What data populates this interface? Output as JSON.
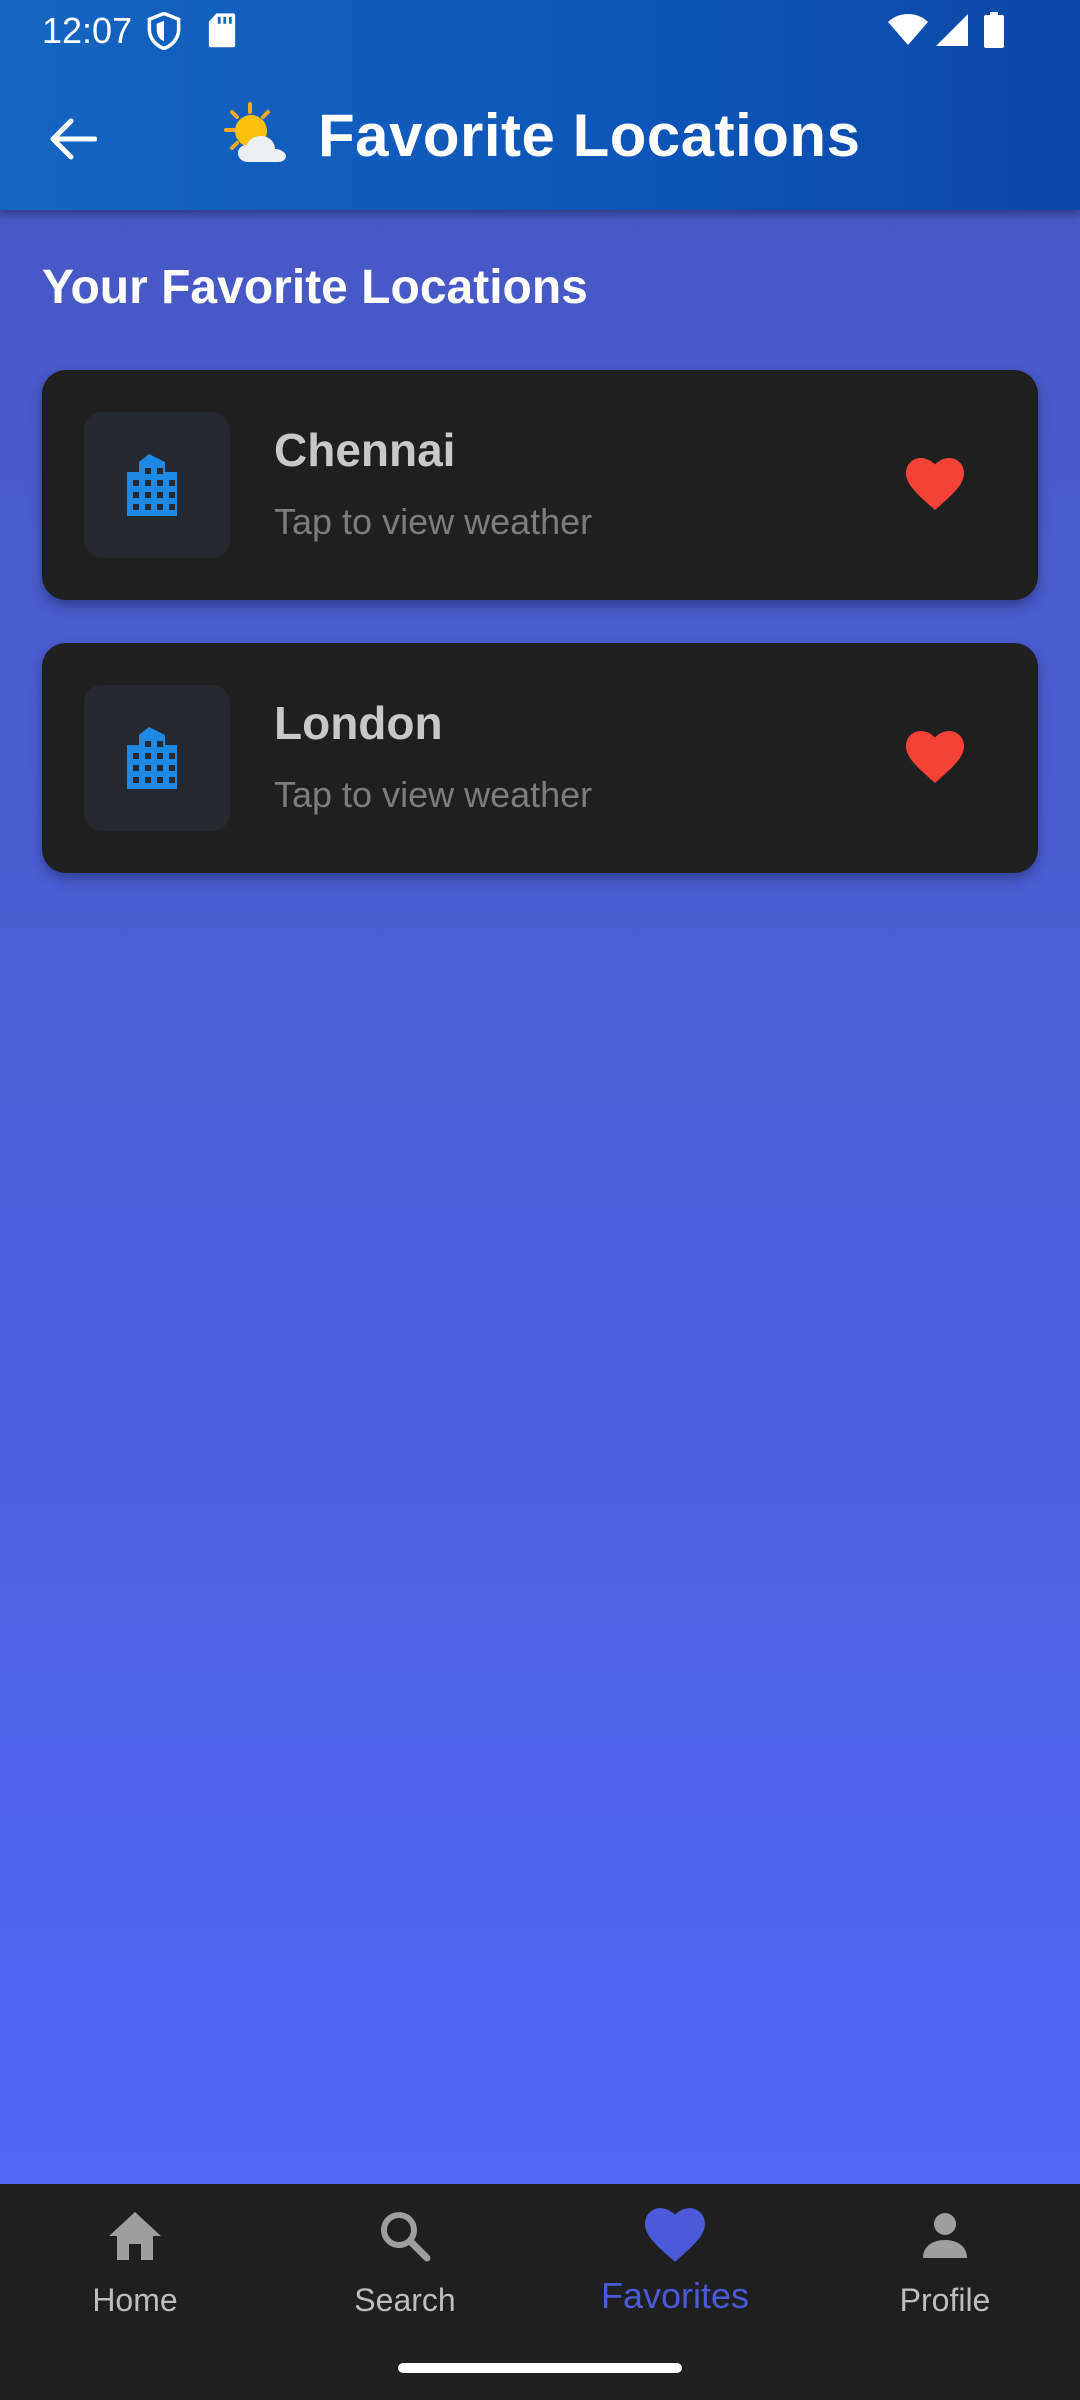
{
  "status_bar": {
    "time": "12:07",
    "icons": [
      "shield-icon",
      "sd-card-icon",
      "wifi-icon",
      "cellular-signal-icon",
      "battery-icon"
    ]
  },
  "app_bar": {
    "back_icon": "arrow-left-icon",
    "weather_icon": "sun-cloud-icon",
    "title": "Favorite Locations"
  },
  "main": {
    "section_title": "Your Favorite Locations",
    "favorites": [
      {
        "name": "Chennai",
        "subtitle": "Tap to view weather",
        "icon": "city-icon",
        "favorite_icon": "heart-icon"
      },
      {
        "name": "London",
        "subtitle": "Tap to view weather",
        "icon": "city-icon",
        "favorite_icon": "heart-icon"
      }
    ]
  },
  "bottom_nav": {
    "items": [
      {
        "label": "Home",
        "icon": "home-icon",
        "active": false
      },
      {
        "label": "Search",
        "icon": "search-icon",
        "active": false
      },
      {
        "label": "Favorites",
        "icon": "heart-icon",
        "active": true
      },
      {
        "label": "Profile",
        "icon": "person-icon",
        "active": false
      }
    ]
  },
  "colors": {
    "app_bar": "#1565c0",
    "background_top": "#4657c0",
    "background_bottom": "#5369fb",
    "card": "#1f1f1f",
    "city_icon": "#1e88e5",
    "heart": "#f44336",
    "nav_active": "#4a5ad8",
    "nav_inactive": "#bdbdbd"
  }
}
